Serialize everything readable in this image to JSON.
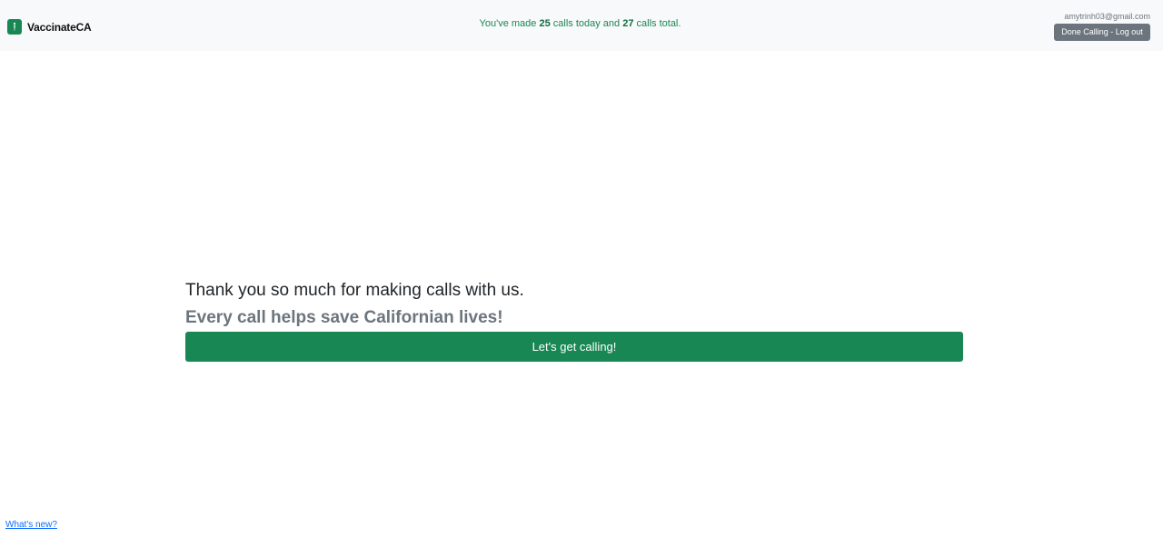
{
  "brand": {
    "name": "VaccinateCA"
  },
  "stats": {
    "prefix": "You've made ",
    "today_count": "25",
    "middle": " calls today and ",
    "total_count": "27",
    "suffix": " calls total."
  },
  "user": {
    "email": "amytrinh03@gmail.com",
    "logout_label": "Done Calling - Log out"
  },
  "main": {
    "title": "Thank you so much for making calls with us.",
    "subtitle": "Every call helps save Californian lives!",
    "cta_label": "Let's get calling!"
  },
  "footer": {
    "whats_new": "What's new?"
  },
  "colors": {
    "accent": "#198754",
    "secondary": "#6c757d",
    "navbar_bg": "#f8f9fa",
    "link": "#0d6efd"
  }
}
